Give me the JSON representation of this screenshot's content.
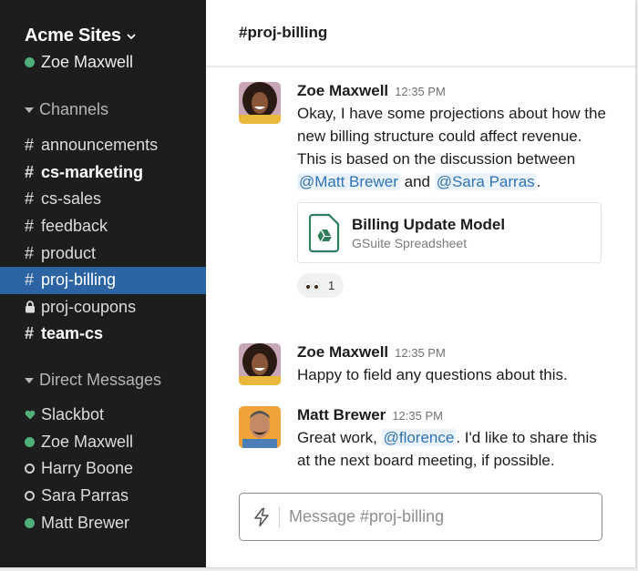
{
  "workspace": {
    "name": "Acme Sites",
    "current_user": "Zoe Maxwell",
    "current_user_status": "online"
  },
  "sidebar": {
    "channels_heading": "Channels",
    "channels": [
      {
        "name": "announcements",
        "icon": "hash-icon",
        "unread": false,
        "active": false
      },
      {
        "name": "cs-marketing",
        "icon": "hash-icon",
        "unread": true,
        "active": false
      },
      {
        "name": "cs-sales",
        "icon": "hash-icon",
        "unread": false,
        "active": false
      },
      {
        "name": "feedback",
        "icon": "hash-icon",
        "unread": false,
        "active": false
      },
      {
        "name": "product",
        "icon": "hash-icon",
        "unread": false,
        "active": false
      },
      {
        "name": "proj-billing",
        "icon": "hash-icon",
        "unread": false,
        "active": true
      },
      {
        "name": "proj-coupons",
        "icon": "lock-icon",
        "unread": false,
        "active": false
      },
      {
        "name": "team-cs",
        "icon": "hash-icon",
        "unread": true,
        "active": false
      }
    ],
    "dm_heading": "Direct Messages",
    "direct_messages": [
      {
        "name": "Slackbot",
        "presence": "bot"
      },
      {
        "name": "Zoe Maxwell",
        "presence": "online"
      },
      {
        "name": "Harry Boone",
        "presence": "away"
      },
      {
        "name": "Sara Parras",
        "presence": "away"
      },
      {
        "name": "Matt Brewer",
        "presence": "online"
      }
    ]
  },
  "channel": {
    "title": "#proj-billing"
  },
  "messages": [
    {
      "author": "Zoe Maxwell",
      "time": "12:35 PM",
      "text_parts": [
        "Okay, I have some projections about how the new billing structure could affect revenue. This is based on the discussion between ",
        "@Matt Brewer",
        " and ",
        "@Sara Parras",
        "."
      ],
      "attachment": {
        "title": "Billing Update Model",
        "subtitle": "GSuite Spreadsheet",
        "icon": "google-drive-file-icon"
      },
      "reaction": {
        "emoji": "eyes",
        "count": "1"
      }
    },
    {
      "author": "Zoe Maxwell",
      "time": "12:35 PM",
      "text": "Happy to field any questions about this."
    },
    {
      "author": "Matt Brewer",
      "time": "12:35 PM",
      "text_parts": [
        "Great work, ",
        "@florence",
        ". I'd like to share this at the next board meeting, if possible."
      ]
    }
  ],
  "composer": {
    "placeholder": "Message #proj-billing",
    "value": ""
  },
  "colors": {
    "sidebar_bg": "#1d1d1d",
    "active_channel": "#2c63a3",
    "presence_online": "#4fb07a",
    "mention_text": "#2f72b8",
    "mention_bg": "#eaf3fb",
    "drive_icon": "#2e7d5b"
  }
}
